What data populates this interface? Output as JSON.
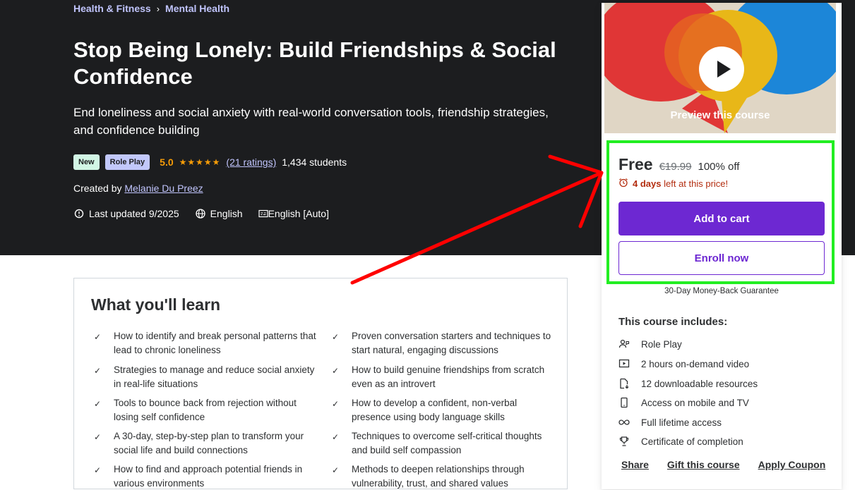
{
  "breadcrumb": {
    "items": [
      "Health & Fitness",
      "Mental Health"
    ],
    "separator": "›"
  },
  "course": {
    "title": "Stop Being Lonely: Build Friendships & Social Confidence",
    "subtitle": "End loneliness and social anxiety with real-world conversation tools, friendship strategies, and confidence building",
    "badges": [
      "New",
      "Role Play"
    ],
    "rating_value": "5.0",
    "stars": "★★★★★",
    "rating_count": "(21 ratings)",
    "students": "1,434 students",
    "created_by_label": "Created by",
    "instructor": "Melanie Du Preez",
    "last_updated": "Last updated 9/2025",
    "language": "English",
    "captions": "English [Auto]"
  },
  "learn": {
    "title": "What you'll learn",
    "check_glyph": "✓",
    "items": [
      "How to identify and break personal patterns that lead to chronic loneliness",
      "Proven conversation starters and techniques to start natural, engaging discussions",
      "Strategies to manage and reduce social anxiety in real-life situations",
      "How to build genuine friendships from scratch even as an introvert",
      "Tools to bounce back from rejection without losing self confidence",
      "How to develop a confident, non-verbal presence using body language skills",
      "A 30-day, step-by-step plan to transform your social life and build connections",
      "Techniques to overcome self-critical thoughts and build self compassion",
      "How to find and approach potential friends in various environments",
      "Methods to deepen relationships through vulnerability, trust, and shared values"
    ]
  },
  "sidebar": {
    "preview_label": "Preview this course",
    "price_current": "Free",
    "price_original": "€19.99",
    "discount": "100% off",
    "timer_bold": "4 days",
    "timer_rest": "left at this price!",
    "add_to_cart": "Add to cart",
    "enroll_now": "Enroll now",
    "guarantee": "30-Day Money-Back Guarantee",
    "includes_title": "This course includes:",
    "includes": [
      {
        "icon": "role-play-icon",
        "label": "Role Play"
      },
      {
        "icon": "video-icon",
        "label": "2 hours on-demand video"
      },
      {
        "icon": "file-download-icon",
        "label": "12 downloadable resources"
      },
      {
        "icon": "mobile-icon",
        "label": "Access on mobile and TV"
      },
      {
        "icon": "infinity-icon",
        "label": "Full lifetime access"
      },
      {
        "icon": "trophy-icon",
        "label": "Certificate of completion"
      }
    ],
    "links": [
      "Share",
      "Gift this course",
      "Apply Coupon"
    ]
  },
  "colors": {
    "hero_bg": "#1c1d1f",
    "accent_purple": "#6d28d2",
    "link_lavender": "#c0c4fc",
    "star_orange": "#f69c08",
    "timer_red": "#b32d0f",
    "annotation_green": "#22ee22",
    "annotation_red": "#ff0000"
  }
}
